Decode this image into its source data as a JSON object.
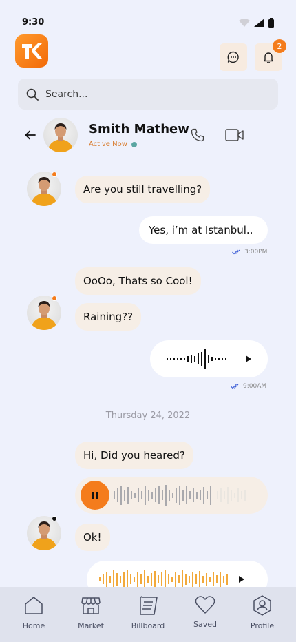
{
  "status": {
    "time": "9:30"
  },
  "header": {
    "logo_text": "TK",
    "notification_count": "2"
  },
  "search": {
    "placeholder": "Search..."
  },
  "contact": {
    "name": "Smith Mathew",
    "status": "Active Now"
  },
  "messages": {
    "m1": "Are you still travelling?",
    "m2": "Yes, i’m at Istanbul..",
    "m2_time": "3:00PM",
    "m3": "OoOo, Thats so Cool!",
    "m4": "Raining??",
    "m5_time": "9:00AM",
    "date_separator": "Thursday 24, 2022",
    "m6": "Hi, Did you heared?",
    "m7": "Ok!"
  },
  "tabs": [
    {
      "label": "Home"
    },
    {
      "label": "Market"
    },
    {
      "label": "Billboard"
    },
    {
      "label": "Saved"
    },
    {
      "label": "Profile"
    }
  ],
  "colors": {
    "accent": "#f47c1c",
    "incoming_bubble": "#f6eee6",
    "outgoing_bubble": "#ffffff",
    "background": "#eef1fc",
    "online": "#5aa6a2",
    "read_check": "#3e5fd6"
  },
  "icons": [
    "wifi-icon",
    "signal-icon",
    "battery-icon",
    "chat-icon",
    "bell-icon",
    "search-icon",
    "back-arrow-icon",
    "phone-icon",
    "video-icon",
    "play-icon",
    "pause-icon",
    "double-check-icon",
    "home-icon",
    "market-icon",
    "billboard-icon",
    "heart-icon",
    "profile-icon"
  ]
}
